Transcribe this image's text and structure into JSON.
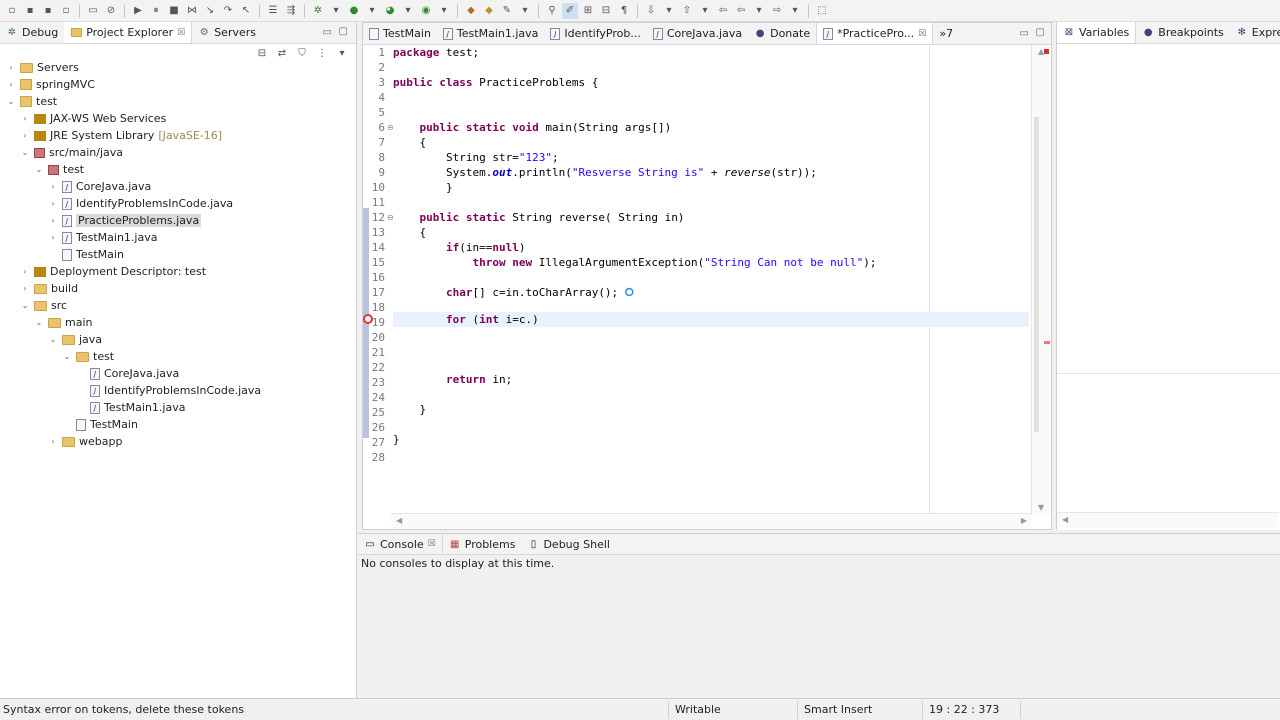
{
  "left_tabs": [
    {
      "label": "Debug"
    },
    {
      "label": "Project Explorer",
      "close": "☒"
    },
    {
      "label": "Servers"
    }
  ],
  "tree": [
    {
      "label": "Servers"
    },
    {
      "label": "springMVC"
    },
    {
      "label": "test"
    },
    {
      "label": "JAX-WS Web Services"
    },
    {
      "label": "JRE System Library",
      "decor": "[JavaSE-16]"
    },
    {
      "label": "src/main/java"
    },
    {
      "label": "test"
    },
    {
      "label": "CoreJava.java"
    },
    {
      "label": "IdentifyProblemsInCode.java"
    },
    {
      "label": "PracticeProblems.java"
    },
    {
      "label": "TestMain1.java"
    },
    {
      "label": "TestMain"
    },
    {
      "label": "Deployment Descriptor: test"
    },
    {
      "label": "build"
    },
    {
      "label": "src"
    },
    {
      "label": "main"
    },
    {
      "label": "java"
    },
    {
      "label": "test"
    },
    {
      "label": "CoreJava.java"
    },
    {
      "label": "IdentifyProblemsInCode.java"
    },
    {
      "label": "TestMain1.java"
    },
    {
      "label": "TestMain"
    },
    {
      "label": "webapp"
    }
  ],
  "editor_tabs": [
    {
      "label": "TestMain"
    },
    {
      "label": "TestMain1.java"
    },
    {
      "label": "IdentifyProb..."
    },
    {
      "label": "CoreJava.java"
    },
    {
      "label": "Donate"
    },
    {
      "label": "*PracticePro...",
      "close": "☒"
    },
    {
      "label": "»7"
    }
  ],
  "line_numbers": [
    "1",
    "2",
    "3",
    "4",
    "5",
    "6",
    "7",
    "8",
    "9",
    "10",
    "11",
    "12",
    "13",
    "14",
    "15",
    "16",
    "17",
    "18",
    "19",
    "20",
    "21",
    "22",
    "23",
    "24",
    "25",
    "26",
    "27",
    "28"
  ],
  "code": {
    "l1_kw": "package",
    "l1_rest": " test;",
    "l3_kw1": "public",
    "l3_kw2": "class",
    "l3_rest": " PracticeProblems {",
    "l6_kw1": "public",
    "l6_kw2": "static",
    "l6_kw3": "void",
    "l6_rest": " main(String args[])",
    "l7": "    {",
    "l8_a": "        String str=",
    "l8_str": "\"123\"",
    "l8_b": ";",
    "l9_a": "        System.",
    "l9_fld": "out",
    "l9_b": ".println(",
    "l9_str": "\"Resverse String is\"",
    "l9_c": " + ",
    "l9_ital": "reverse",
    "l9_d": "(str));",
    "l10": "        }",
    "l12_kw1": "public",
    "l12_kw2": "static",
    "l12_rest": " String reverse( String in)",
    "l13": "    {",
    "l14_kw": "if",
    "l14_a": "(in==",
    "l14_kw2": "null",
    "l14_b": ")",
    "l15_kw1": "throw",
    "l15_kw2": "new",
    "l15_a": " IllegalArgumentException(",
    "l15_str": "\"String Can not be null\"",
    "l15_b": ");",
    "l17_kw": "char",
    "l17_rest": "[] c=in.toCharArray();",
    "l19_kw": "for",
    "l19_a": " (",
    "l19_kw2": "int",
    "l19_b": " i=c.)",
    "l22_kw": "return",
    "l22_rest": " in;",
    "l25": "    }",
    "l27": "}"
  },
  "right_tabs": [
    {
      "label": "Variables"
    },
    {
      "label": "Breakpoints"
    },
    {
      "label": "Expressio"
    }
  ],
  "console_tabs": [
    {
      "label": "Console",
      "close": "☒"
    },
    {
      "label": "Problems"
    },
    {
      "label": "Debug Shell"
    }
  ],
  "console_message": "No consoles to display at this time.",
  "status": {
    "message": "Syntax error on tokens, delete these tokens",
    "mode": "Writable",
    "insert": "Smart Insert",
    "position": "19 : 22 : 373"
  },
  "colors": {
    "keyword": "#7f0055",
    "string": "#2a00ff",
    "field": "#0000c0"
  }
}
